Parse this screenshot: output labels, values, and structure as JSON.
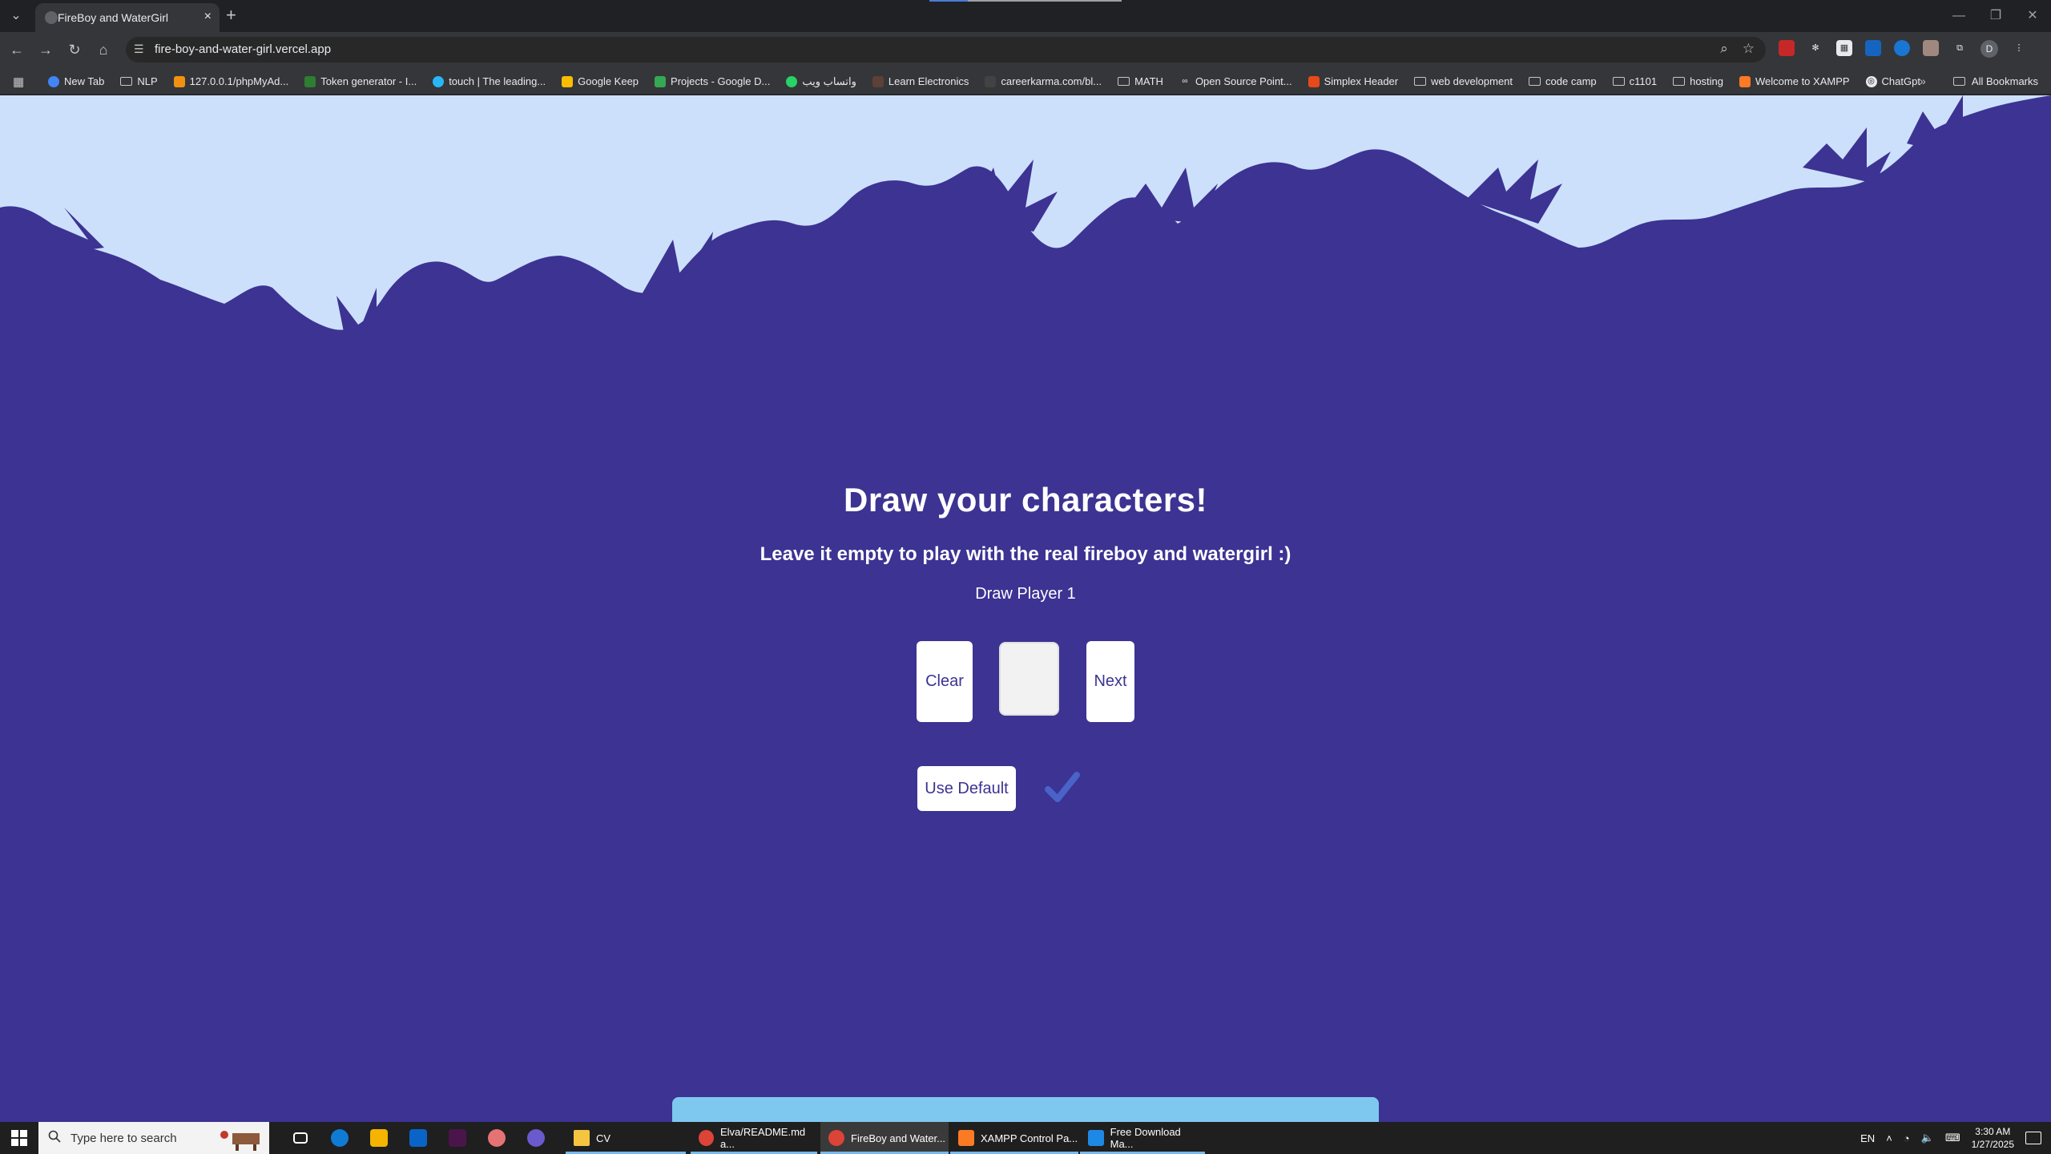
{
  "browser": {
    "tab_title": "FireBoy and WaterGirl",
    "url": "fire-boy-and-water-girl.vercel.app",
    "profile_initial": "D",
    "bookmarks": [
      "New Tab",
      "NLP",
      "127.0.0.1/phpMyAd...",
      "Token generator - I...",
      "touch | The leading...",
      "Google Keep",
      "Projects - Google D...",
      "واتساب ويب",
      "Learn Electronics",
      "careerkarma.com/bl...",
      "MATH",
      "Open Source Point...",
      "Simplex Header",
      "web development",
      "code camp",
      "c1101",
      "hosting",
      "Welcome to XAMPP",
      "ChatGpt"
    ],
    "all_bookmarks": "All Bookmarks"
  },
  "page": {
    "heading": "Draw your characters!",
    "subheading": "Leave it empty to play with the real fireboy and watergirl :)",
    "player_label": "Draw Player 1",
    "clear_button": "Clear",
    "next_button": "Next",
    "default_button": "Use Default"
  },
  "taskbar": {
    "search_placeholder": "Type here to search",
    "apps": [
      "Elva/README.md a...",
      "FireBoy and Water...",
      "XAMPP Control Pa...",
      "Free Download Ma..."
    ],
    "pinned_folder": "CV",
    "language": "EN",
    "time": "3:30 AM",
    "date": "1/27/2025"
  },
  "colors": {
    "page_bg": "#3c3393",
    "sky": "#cde0fb",
    "accent_check": "#4a63c8"
  }
}
